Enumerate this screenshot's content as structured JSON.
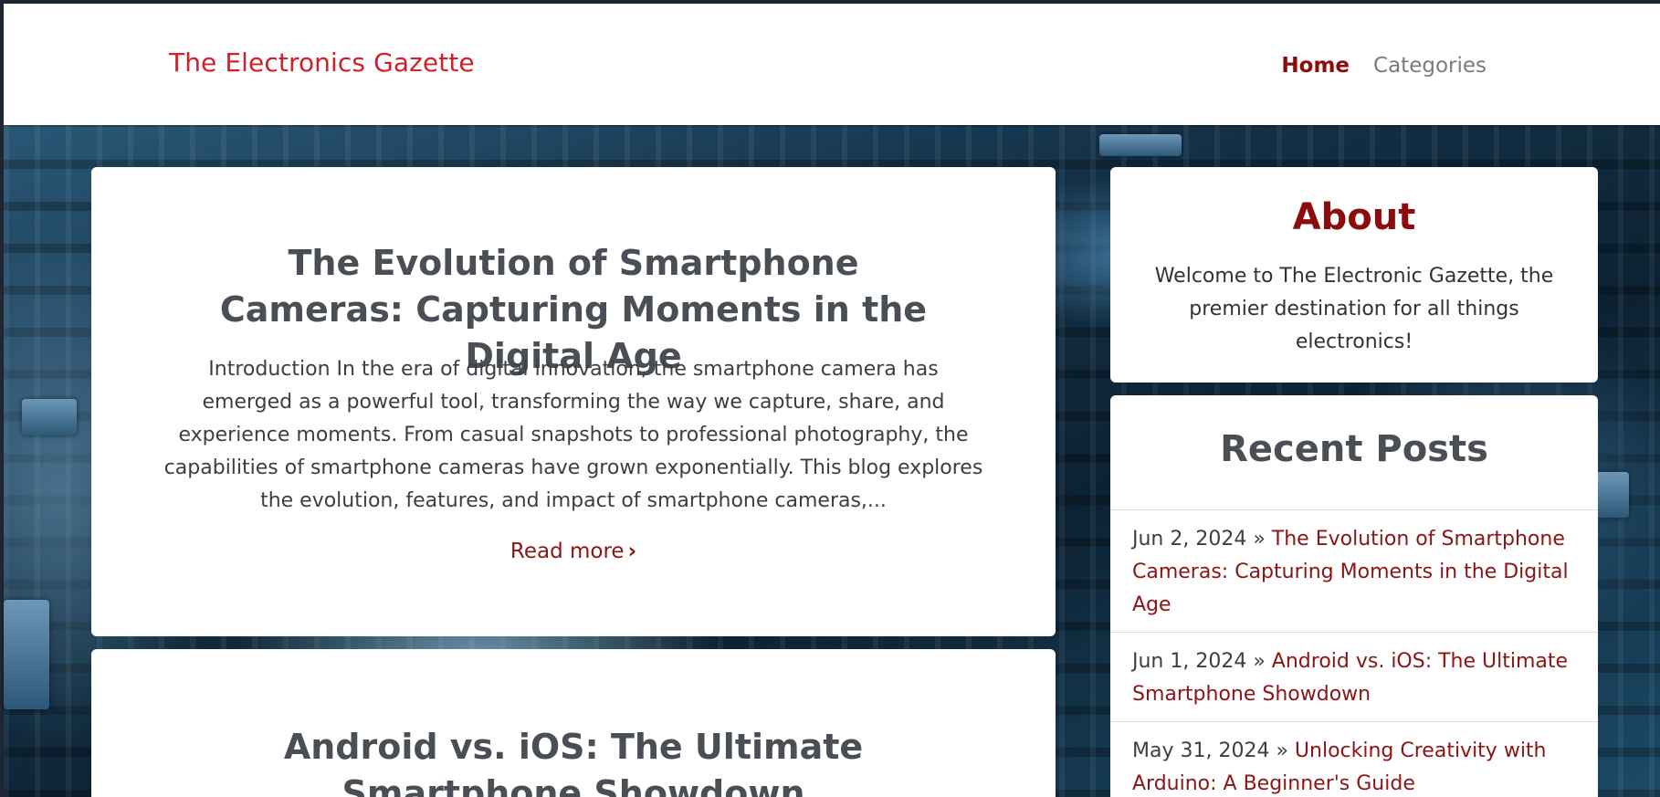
{
  "header": {
    "brand": "The Electronics Gazette",
    "nav": [
      {
        "label": "Home",
        "active": true
      },
      {
        "label": "Categories",
        "active": false
      }
    ]
  },
  "posts": [
    {
      "title": "The Evolution of Smartphone Cameras: Capturing Moments in the Digital Age",
      "excerpt": "Introduction In the era of digital innovation, the smartphone camera has emerged as a powerful tool, transforming the way we capture, share, and experience moments. From casual snapshots to professional photography, the capabilities of smartphone cameras have grown exponentially. This blog explores the evolution, features, and impact of smartphone cameras,...",
      "read_more": "Read more"
    },
    {
      "title": "Android vs. iOS: The Ultimate Smartphone Showdown"
    }
  ],
  "sidebar": {
    "about": {
      "title": "About",
      "text": "Welcome to The Electronic Gazette, the premier destination for all things electronics!"
    },
    "recent": {
      "title": "Recent Posts",
      "items": [
        {
          "date": "Jun 2, 2024",
          "sep": " » ",
          "title": "The Evolution of Smartphone Cameras: Capturing Moments in the Digital Age"
        },
        {
          "date": "Jun 1, 2024",
          "sep": " » ",
          "title": "Android vs. iOS: The Ultimate Smartphone Showdown"
        },
        {
          "date": "May 31, 2024",
          "sep": " » ",
          "title": "Unlocking Creativity with Arduino: A Beginner's Guide"
        }
      ]
    }
  },
  "icons": {
    "read_more_chevron": "chevron-right-icon"
  },
  "colors": {
    "brand": "#d2202a",
    "accent": "#8b0c0c",
    "link": "#8b1414",
    "heading": "#4a4f55"
  }
}
